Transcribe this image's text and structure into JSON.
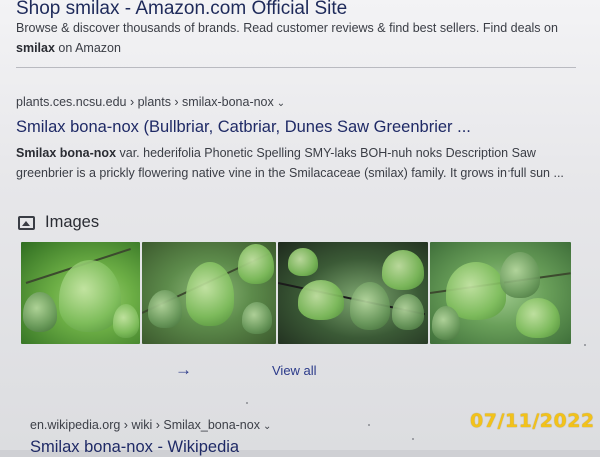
{
  "ad": {
    "title": "Shop smilax - Amazon.com Official Site",
    "desc_pre": "Browse & discover thousands of brands. Read customer reviews & find best sellers. Find deals on ",
    "desc_bold": "smilax",
    "desc_post": " on Amazon"
  },
  "result1": {
    "breadcrumb": "plants.ces.ncsu.edu › plants › smilax-bona-nox",
    "title": "Smilax bona-nox (Bullbriar, Catbriar, Dunes Saw Greenbrier ...",
    "snippet_bold": "Smilax bona-nox",
    "snippet_text": " var. hederifolia Phonetic Spelling SMY-laks BOH-nuh noks Description Saw greenbrier is a prickly flowering native vine in the Smilacaceae (smilax) family. It grows in full sun ..."
  },
  "images": {
    "icon": "image-icon",
    "label": "Images",
    "view_all": "View all",
    "arrow_icon": "arrow-right-icon",
    "thumbnails": [
      {
        "name": "thumbnail-1"
      },
      {
        "name": "thumbnail-2"
      },
      {
        "name": "thumbnail-3"
      },
      {
        "name": "thumbnail-4"
      }
    ]
  },
  "result2": {
    "breadcrumb": "en.wikipedia.org › wiki › Smilax_bona-nox",
    "title": "Smilax bona-nox - Wikipedia"
  },
  "photo_overlay": {
    "date_stamp": "07/11/2022",
    "date_color": "#f2c21a"
  },
  "colors": {
    "link": "#1f2a66",
    "text": "#3a3d45",
    "accent": "#2b3a8a"
  }
}
